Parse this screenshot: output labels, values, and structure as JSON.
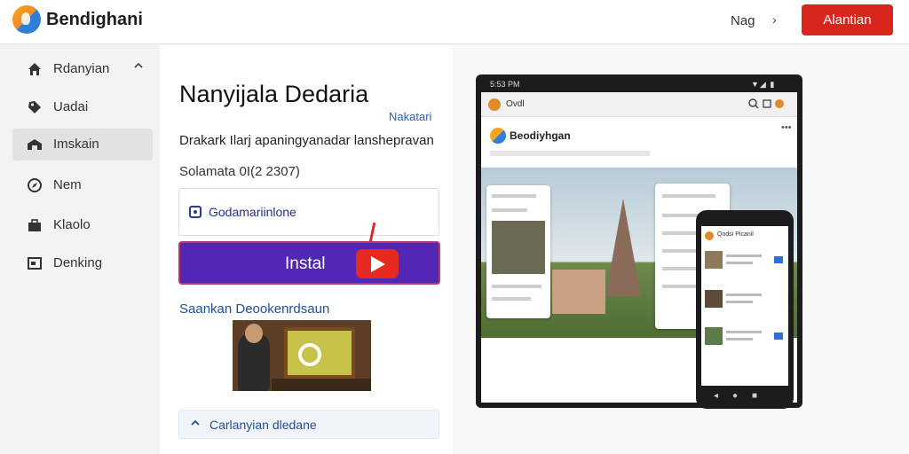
{
  "header": {
    "brand": "Bendighani",
    "nav_link": "Nag",
    "nav_chevron": "›",
    "cta_label": "Alantian",
    "cta_color": "#d8261d"
  },
  "sidebar": {
    "items": [
      {
        "label": "Rdanyian",
        "icon": "home-icon",
        "caret": "^"
      },
      {
        "label": "Uadai",
        "icon": "tag-icon"
      },
      {
        "label": "Imskain",
        "icon": "warehouse-icon",
        "active": true
      },
      {
        "label": "Nem",
        "icon": "compass-icon"
      },
      {
        "label": "Klaolo",
        "icon": "briefcase-icon"
      },
      {
        "label": "Denking",
        "icon": "screen-icon"
      }
    ]
  },
  "main": {
    "title": "Nanyijala Dedaria",
    "title_link": "Nakatari",
    "subtitle": "Drakark Ilarj apaningyanadar lanshepravan",
    "meta": "Solamata 0I(2 2307)",
    "field_text": "Godamariinlone",
    "install_label": "Instal",
    "install_color": "#5227b5",
    "section_link": "Saankan Deookenrdsaun",
    "accordion_label": "Carlanyian dledane"
  },
  "preview": {
    "tablet_status_left": "5:53 PM",
    "tablet_status_right": "▼◢ ▮",
    "tablet_app_title": "Ovdl",
    "tablet_brand": "Beodiyhgan",
    "phone_title": "Qodsi Picanil"
  }
}
